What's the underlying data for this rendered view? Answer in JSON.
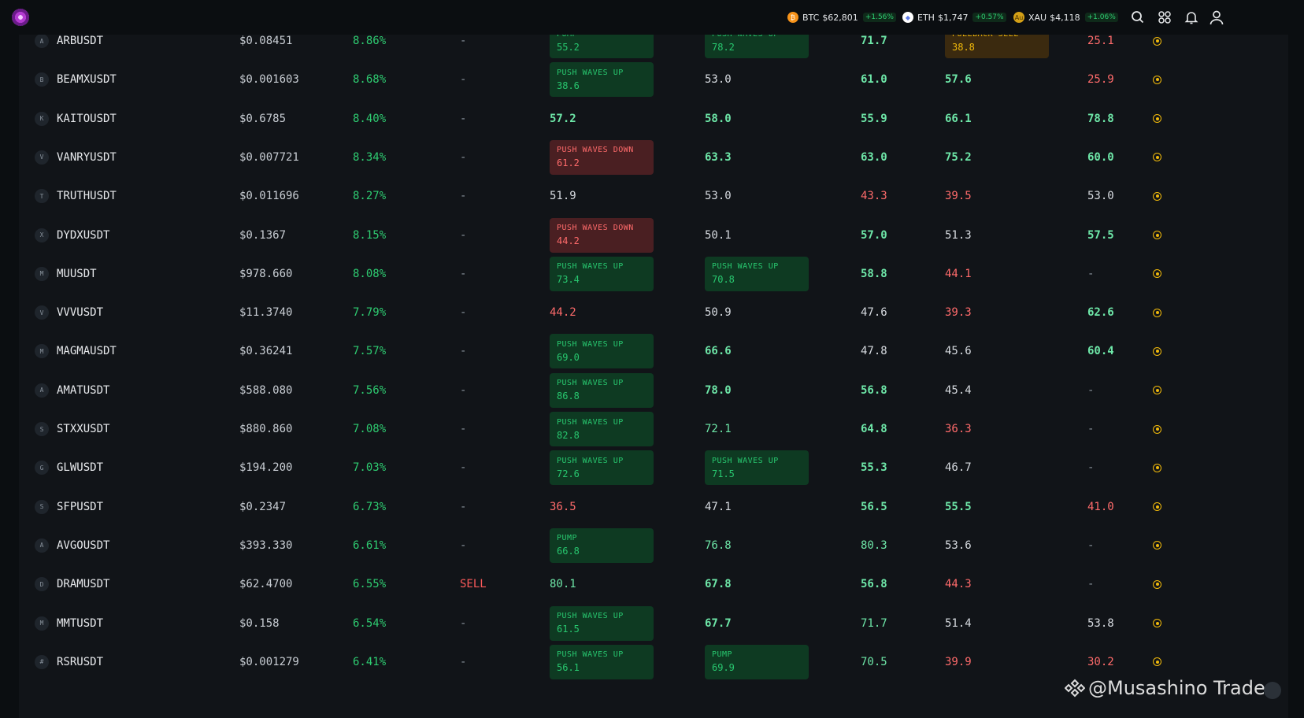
{
  "topbar": {
    "tickers": [
      {
        "symbol": "BTC",
        "price": "$62,801",
        "change": "+1.56%",
        "icon": "bitcoin-icon",
        "color": "#f7931a"
      },
      {
        "symbol": "ETH",
        "price": "$1,747",
        "change": "+0.57%",
        "icon": "ethereum-icon",
        "color": "#627eea"
      },
      {
        "symbol": "XAU",
        "price": "$4,118",
        "change": "+1.06%",
        "icon": "gold-icon",
        "color": "#d4a017"
      }
    ],
    "icons": [
      "search-icon",
      "apps-grid-icon",
      "bell-icon",
      "user-icon"
    ]
  },
  "rows": [
    {
      "icon": "A",
      "symbol": "ARBUSDT",
      "price": "$0.08451",
      "change": "8.86%",
      "signal": "-",
      "c1": {
        "tag": "up",
        "label": "PUMP",
        "value": "55.2"
      },
      "c2": {
        "tag": "up",
        "label": "PUSH WAVES UP",
        "value": "78.2"
      },
      "c3": {
        "text": "71.7",
        "cls": "g"
      },
      "c4": {
        "tag": "pull",
        "label": "PULLBACK SELL",
        "value": "38.8"
      },
      "c5": {
        "text": "25.1",
        "cls": "r"
      }
    },
    {
      "icon": "B",
      "symbol": "BEAMXUSDT",
      "price": "$0.001603",
      "change": "8.68%",
      "signal": "-",
      "c1": {
        "tag": "up",
        "label": "PUSH WAVES UP",
        "value": "38.6"
      },
      "c2": {
        "text": "53.0",
        "cls": "w"
      },
      "c3": {
        "text": "61.0",
        "cls": "g"
      },
      "c4": {
        "text": "57.6",
        "cls": "g"
      },
      "c5": {
        "text": "25.9",
        "cls": "r"
      }
    },
    {
      "icon": "K",
      "symbol": "KAITOUSDT",
      "price": "$0.6785",
      "change": "8.40%",
      "signal": "-",
      "c1": {
        "text": "57.2",
        "cls": "g"
      },
      "c2": {
        "text": "58.0",
        "cls": "g"
      },
      "c3": {
        "text": "55.9",
        "cls": "g"
      },
      "c4": {
        "text": "66.1",
        "cls": "g"
      },
      "c5": {
        "text": "78.8",
        "cls": "g"
      }
    },
    {
      "icon": "V",
      "symbol": "VANRYUSDT",
      "price": "$0.007721",
      "change": "8.34%",
      "signal": "-",
      "c1": {
        "tag": "down",
        "label": "PUSH WAVES DOWN",
        "value": "61.2"
      },
      "c2": {
        "text": "63.3",
        "cls": "g"
      },
      "c3": {
        "text": "63.0",
        "cls": "g"
      },
      "c4": {
        "text": "75.2",
        "cls": "g"
      },
      "c5": {
        "text": "60.0",
        "cls": "g"
      }
    },
    {
      "icon": "T",
      "symbol": "TRUTHUSDT",
      "price": "$0.011696",
      "change": "8.27%",
      "signal": "-",
      "c1": {
        "text": "51.9",
        "cls": "w"
      },
      "c2": {
        "text": "53.0",
        "cls": "w"
      },
      "c3": {
        "text": "43.3",
        "cls": "r"
      },
      "c4": {
        "text": "39.5",
        "cls": "r"
      },
      "c5": {
        "text": "53.0",
        "cls": "w"
      }
    },
    {
      "icon": "X",
      "symbol": "DYDXUSDT",
      "price": "$0.1367",
      "change": "8.15%",
      "signal": "-",
      "c1": {
        "tag": "down",
        "label": "PUSH WAVES DOWN",
        "value": "44.2"
      },
      "c2": {
        "text": "50.1",
        "cls": "w"
      },
      "c3": {
        "text": "57.0",
        "cls": "g"
      },
      "c4": {
        "text": "51.3",
        "cls": "w"
      },
      "c5": {
        "text": "57.5",
        "cls": "g"
      }
    },
    {
      "icon": "M",
      "symbol": "MUUSDT",
      "price": "$978.660",
      "change": "8.08%",
      "signal": "-",
      "c1": {
        "tag": "up",
        "label": "PUSH WAVES UP",
        "value": "73.4"
      },
      "c2": {
        "tag": "up",
        "label": "PUSH WAVES UP",
        "value": "70.8"
      },
      "c3": {
        "text": "58.8",
        "cls": "g"
      },
      "c4": {
        "text": "44.1",
        "cls": "r"
      },
      "c5": {
        "text": "-",
        "cls": "d"
      }
    },
    {
      "icon": "V",
      "symbol": "VVVUSDT",
      "price": "$11.3740",
      "change": "7.79%",
      "signal": "-",
      "c1": {
        "text": "44.2",
        "cls": "r"
      },
      "c2": {
        "text": "50.9",
        "cls": "w"
      },
      "c3": {
        "text": "47.6",
        "cls": "w"
      },
      "c4": {
        "text": "39.3",
        "cls": "r"
      },
      "c5": {
        "text": "62.6",
        "cls": "g"
      }
    },
    {
      "icon": "M",
      "symbol": "MAGMAUSDT",
      "price": "$0.36241",
      "change": "7.57%",
      "signal": "-",
      "c1": {
        "tag": "up",
        "label": "PUSH WAVES UP",
        "value": "69.0"
      },
      "c2": {
        "text": "66.6",
        "cls": "g"
      },
      "c3": {
        "text": "47.8",
        "cls": "w"
      },
      "c4": {
        "text": "45.6",
        "cls": "w"
      },
      "c5": {
        "text": "60.4",
        "cls": "g"
      }
    },
    {
      "icon": "A",
      "symbol": "AMATUSDT",
      "price": "$588.080",
      "change": "7.56%",
      "signal": "-",
      "c1": {
        "tag": "up",
        "label": "PUSH WAVES UP",
        "value": "86.8"
      },
      "c2": {
        "text": "78.0",
        "cls": "g"
      },
      "c3": {
        "text": "56.8",
        "cls": "g"
      },
      "c4": {
        "text": "45.4",
        "cls": "w"
      },
      "c5": {
        "text": "-",
        "cls": "d"
      }
    },
    {
      "icon": "S",
      "symbol": "STXXUSDT",
      "price": "$880.860",
      "change": "7.08%",
      "signal": "-",
      "c1": {
        "tag": "up",
        "label": "PUSH WAVES UP",
        "value": "82.8"
      },
      "c2": {
        "text": "72.1",
        "cls": "gn"
      },
      "c3": {
        "text": "64.8",
        "cls": "g"
      },
      "c4": {
        "text": "36.3",
        "cls": "r"
      },
      "c5": {
        "text": "-",
        "cls": "d"
      }
    },
    {
      "icon": "G",
      "symbol": "GLWUSDT",
      "price": "$194.200",
      "change": "7.03%",
      "signal": "-",
      "c1": {
        "tag": "up",
        "label": "PUSH WAVES UP",
        "value": "72.6"
      },
      "c2": {
        "tag": "up",
        "label": "PUSH WAVES UP",
        "value": "71.5"
      },
      "c3": {
        "text": "55.3",
        "cls": "g"
      },
      "c4": {
        "text": "46.7",
        "cls": "w"
      },
      "c5": {
        "text": "-",
        "cls": "d"
      }
    },
    {
      "icon": "S",
      "symbol": "SFPUSDT",
      "price": "$0.2347",
      "change": "6.73%",
      "signal": "-",
      "c1": {
        "text": "36.5",
        "cls": "r"
      },
      "c2": {
        "text": "47.1",
        "cls": "w"
      },
      "c3": {
        "text": "56.5",
        "cls": "g"
      },
      "c4": {
        "text": "55.5",
        "cls": "g"
      },
      "c5": {
        "text": "41.0",
        "cls": "r"
      }
    },
    {
      "icon": "A",
      "symbol": "AVGOUSDT",
      "price": "$393.330",
      "change": "6.61%",
      "signal": "-",
      "c1": {
        "tag": "up",
        "label": "PUMP",
        "value": "66.8"
      },
      "c2": {
        "text": "76.8",
        "cls": "gn"
      },
      "c3": {
        "text": "80.3",
        "cls": "gn"
      },
      "c4": {
        "text": "53.6",
        "cls": "w"
      },
      "c5": {
        "text": "-",
        "cls": "d"
      }
    },
    {
      "icon": "D",
      "symbol": "DRAMUSDT",
      "price": "$62.4700",
      "change": "6.55%",
      "signal": "SELL",
      "c1": {
        "text": "80.1",
        "cls": "gn"
      },
      "c2": {
        "text": "67.8",
        "cls": "g"
      },
      "c3": {
        "text": "56.8",
        "cls": "g"
      },
      "c4": {
        "text": "44.3",
        "cls": "r"
      },
      "c5": {
        "text": "-",
        "cls": "d"
      }
    },
    {
      "icon": "M",
      "symbol": "MMTUSDT",
      "price": "$0.158",
      "change": "6.54%",
      "signal": "-",
      "c1": {
        "tag": "up",
        "label": "PUSH WAVES UP",
        "value": "61.5"
      },
      "c2": {
        "text": "67.7",
        "cls": "g"
      },
      "c3": {
        "text": "71.7",
        "cls": "gn"
      },
      "c4": {
        "text": "51.4",
        "cls": "w"
      },
      "c5": {
        "text": "53.8",
        "cls": "w"
      }
    },
    {
      "icon": "#",
      "symbol": "RSRUSDT",
      "price": "$0.001279",
      "change": "6.41%",
      "signal": "-",
      "c1": {
        "tag": "up",
        "label": "PUSH WAVES UP",
        "value": "56.1"
      },
      "c2": {
        "tag": "up",
        "label": "PUMP",
        "value": "69.9"
      },
      "c3": {
        "text": "70.5",
        "cls": "gn"
      },
      "c4": {
        "text": "39.9",
        "cls": "r"
      },
      "c5": {
        "text": "30.2",
        "cls": "r"
      }
    }
  ],
  "watermark": {
    "text": "@Musashino Trader",
    "icon": "binance-icon"
  },
  "colors": {
    "up": "#28c76f",
    "down": "#ff6b6b",
    "accent": "#f0b90b",
    "bg": "#0b0e11"
  }
}
